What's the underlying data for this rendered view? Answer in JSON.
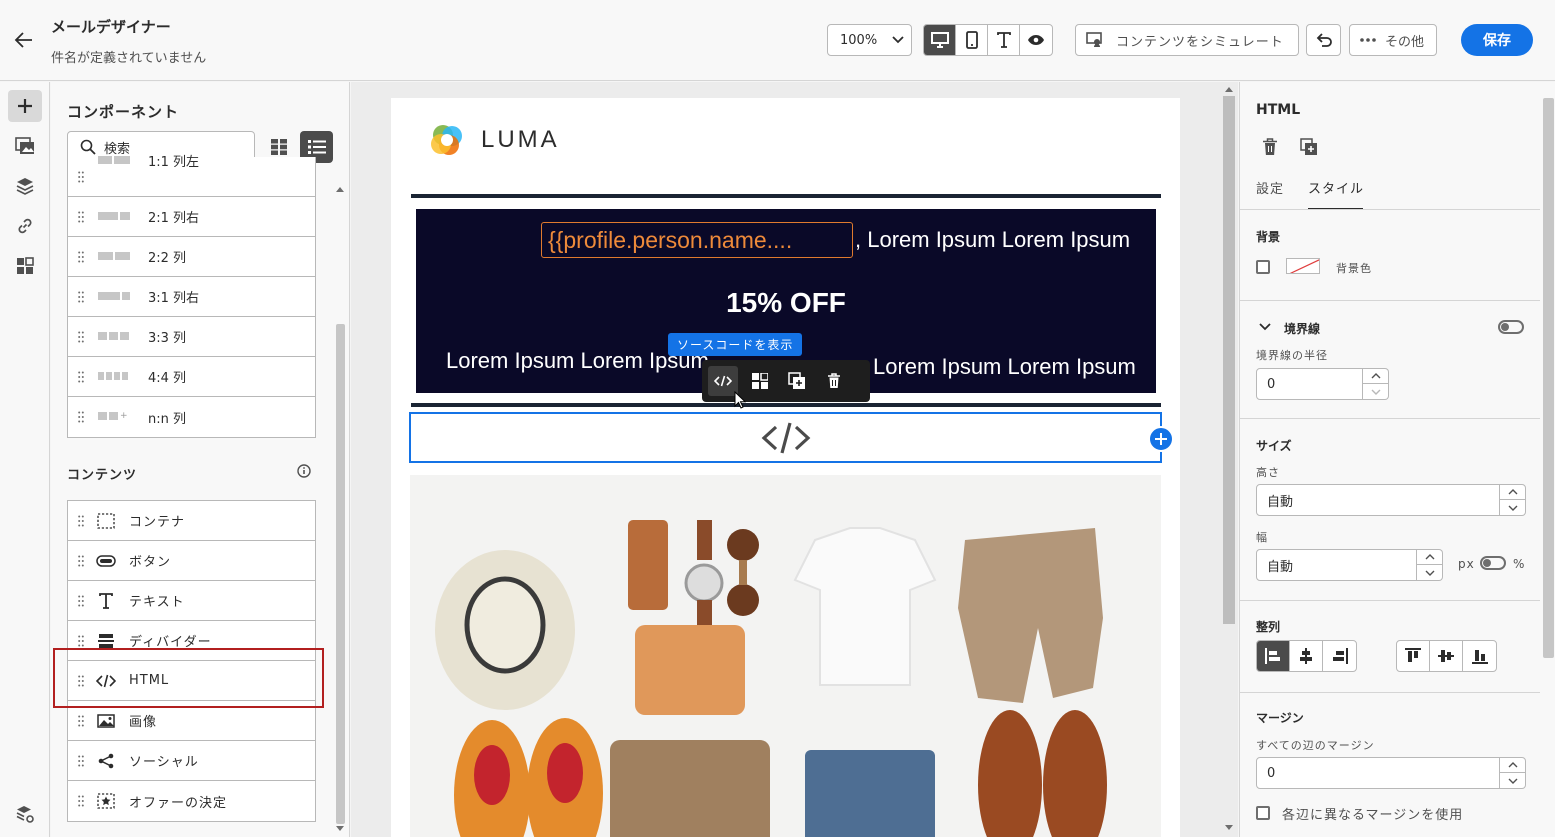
{
  "header": {
    "title": "メールデザイナー",
    "subtitle": "件名が定義されていません",
    "zoom": "100%",
    "simulate_label": "コンテンツをシミュレート",
    "more_label": "その他",
    "save_label": "保存"
  },
  "components": {
    "title": "コンポーネント",
    "search_placeholder": "検索",
    "structures": [
      {
        "label": "1:1 列左"
      },
      {
        "label": "2:1 列右"
      },
      {
        "label": "2:2 列"
      },
      {
        "label": "3:1 列右"
      },
      {
        "label": "3:3 列"
      },
      {
        "label": "4:4 列"
      },
      {
        "label": "n:n 列"
      }
    ],
    "content_header": "コンテンツ",
    "contents": [
      {
        "label": "コンテナ",
        "icon": "container-icon"
      },
      {
        "label": "ボタン",
        "icon": "button-icon"
      },
      {
        "label": "テキスト",
        "icon": "text-icon"
      },
      {
        "label": "ディバイダー",
        "icon": "divider-icon"
      },
      {
        "label": "HTML",
        "icon": "code-icon"
      },
      {
        "label": "画像",
        "icon": "image-icon"
      },
      {
        "label": "ソーシャル",
        "icon": "share-icon"
      },
      {
        "label": "オファーの決定",
        "icon": "offer-decision-icon"
      }
    ]
  },
  "email": {
    "brand": "LUMA",
    "token": "{{profile.person.name....",
    "greeting": ", Lorem Ipsum Lorem Ipsum",
    "offer": "15% OFF",
    "line_left": "Lorem Ipsum Lorem Ipsum",
    "line_right": "Lorem Ipsum Lorem Ipsum",
    "tooltip": "ソースコードを表示"
  },
  "properties": {
    "title": "HTML",
    "tab_settings": "設定",
    "tab_style": "スタイル",
    "background": {
      "header": "背景",
      "color_label": "背景色"
    },
    "border": {
      "header": "境界線",
      "radius_label": "境界線の半径",
      "radius_value": "0"
    },
    "size": {
      "header": "サイズ",
      "height_label": "高さ",
      "height_value": "自動",
      "width_label": "幅",
      "width_value": "自動",
      "unit_px": "px",
      "unit_percent": "%"
    },
    "align": {
      "header": "整列"
    },
    "margin": {
      "header": "マージン",
      "all_label": "すべての辺のマージン",
      "all_value": "0",
      "different_label": "各辺に異なるマージンを使用"
    }
  },
  "colors": {
    "accent": "#1473e6",
    "banner": "#0a0928",
    "token": "#ee8a3a"
  }
}
